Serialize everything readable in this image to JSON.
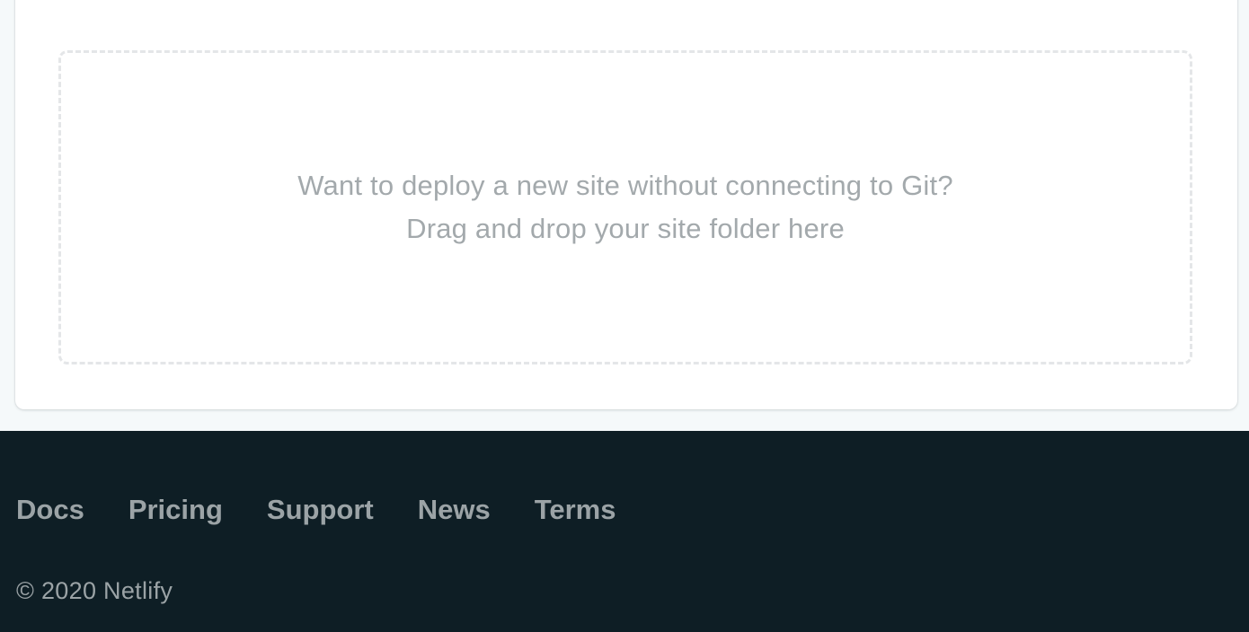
{
  "dropzone": {
    "line1": "Want to deploy a new site without connecting to Git?",
    "line2": "Drag and drop your site folder here"
  },
  "footer": {
    "links": [
      "Docs",
      "Pricing",
      "Support",
      "News",
      "Terms"
    ],
    "copyright": "© 2020 Netlify"
  },
  "colors": {
    "page_background": "#f5f9fa",
    "card_background": "#ffffff",
    "footer_background": "#0e1e25",
    "muted_text": "#a3a9ac",
    "footer_text": "#9ba3a6"
  }
}
